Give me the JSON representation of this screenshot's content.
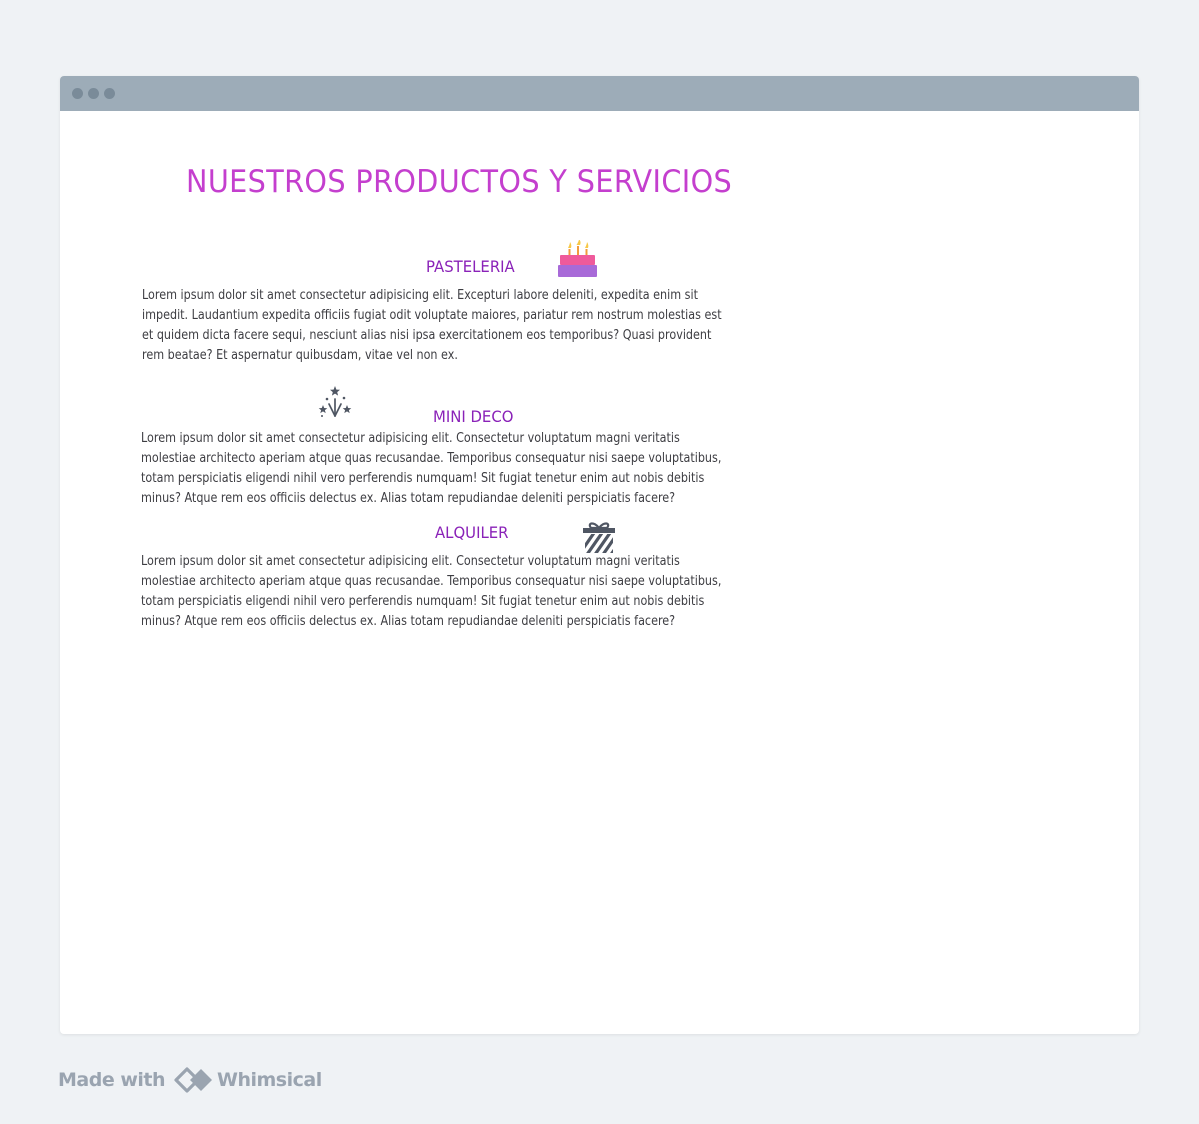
{
  "window": {
    "title_dots": [
      "dot",
      "dot",
      "dot"
    ]
  },
  "page": {
    "title": "NUESTROS PRODUCTOS Y SERVICIOS",
    "title_color": "#c43fce",
    "heading_color": "#8a22b8"
  },
  "sections": [
    {
      "heading": "PASTELERIA",
      "icon": "cake-icon",
      "lines": [
        "Lorem ipsum dolor sit amet consectetur adipisicing elit. Excepturi labore deleniti, expedita enim sit",
        "impedit. Laudantium expedita officiis fugiat odit voluptate maiores, pariatur rem nostrum molestias est",
        "et quidem dicta facere sequi, nesciunt alias nisi ipsa exercitationem eos temporibus? Quasi provident",
        "rem beatae? Et aspernatur quibusdam, vitae vel non ex."
      ]
    },
    {
      "heading": "MINI DECO",
      "icon": "fireworks-icon",
      "lines": [
        "Lorem ipsum dolor sit amet consectetur adipisicing elit. Consectetur voluptatum magni veritatis",
        "molestiae architecto aperiam atque quas recusandae. Temporibus consequatur nisi saepe voluptatibus,",
        "totam perspiciatis eligendi nihil vero perferendis numquam! Sit fugiat tenetur enim aut nobis debitis",
        "minus? Atque rem eos officiis delectus ex. Alias totam repudiandae deleniti perspiciatis facere?"
      ]
    },
    {
      "heading": "ALQUILER",
      "icon": "gift-icon",
      "lines": [
        "Lorem ipsum dolor sit amet consectetur adipisicing elit. Consectetur voluptatum magni veritatis",
        "molestiae architecto aperiam atque quas recusandae. Temporibus consequatur nisi saepe voluptatibus,",
        "totam perspiciatis eligendi nihil vero perferendis numquam! Sit fugiat tenetur enim aut nobis debitis",
        "minus? Atque rem eos officiis delectus ex. Alias totam repudiandae deleniti perspiciatis facere?"
      ]
    }
  ],
  "footer": {
    "made_with": "Made with",
    "brand": "Whimsical",
    "logo_icon": "whimsical-logo-icon"
  }
}
